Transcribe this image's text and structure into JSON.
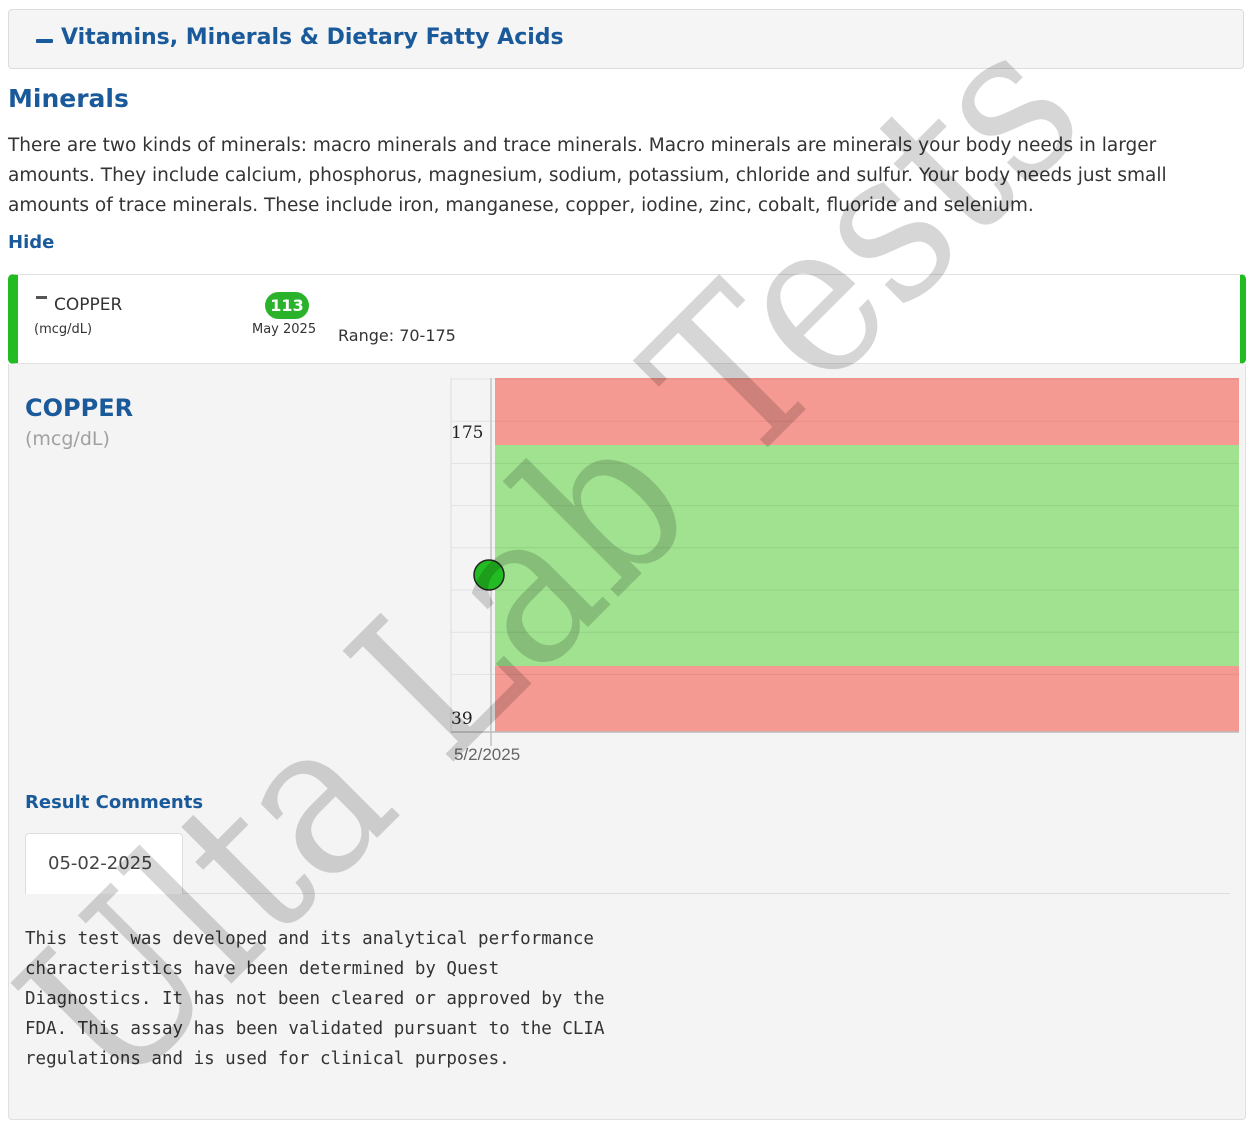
{
  "section": {
    "title": "Vitamins, Minerals & Dietary Fatty Acids"
  },
  "minerals": {
    "title": "Minerals",
    "description": "There are two kinds of minerals: macro minerals and trace minerals. Macro minerals are minerals your body needs in larger amounts. They include calcium, phosphorus, magnesium, sodium, potassium, chloride and sulfur. Your body needs just small amounts of trace minerals. These include iron, manganese, copper, iodine, zinc, cobalt, fluoride and selenium.",
    "hide_label": "Hide"
  },
  "test": {
    "name": "COPPER",
    "unit": "(mcg/dL)",
    "value": "113",
    "date": "May 2025",
    "range": "Range: 70-175",
    "status_color": "#22bb22"
  },
  "detail": {
    "title": "COPPER",
    "unit": "(mcg/dL)"
  },
  "chart_data": {
    "type": "scatter",
    "x": [
      "5/2/2025"
    ],
    "y": [
      113
    ],
    "ylim": [
      39,
      175
    ],
    "ytick_labels": [
      "175",
      "39"
    ],
    "normal_range": [
      70,
      175
    ],
    "colors": {
      "normal": "#a0e290",
      "out_of_range": "#f59a92",
      "point": "#22bb22"
    },
    "grid": true,
    "title": "",
    "xlabel": "",
    "ylabel": ""
  },
  "comments": {
    "title": "Result Comments",
    "tab_label": "05-02-2025",
    "text": "This test was developed and its analytical performance\ncharacteristics have been determined by Quest\nDiagnostics. It has not been cleared or approved by the\nFDA. This assay has been validated pursuant to the CLIA\nregulations and is used for clinical purposes."
  },
  "watermark": {
    "text": "Ulta Lab Tests"
  }
}
